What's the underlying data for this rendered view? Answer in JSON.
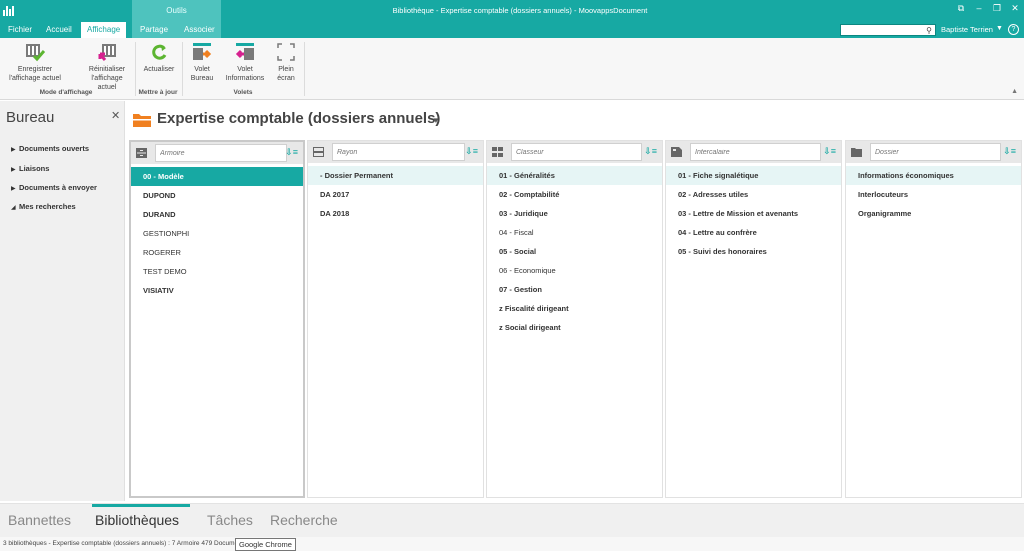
{
  "window": {
    "title": "Bibliothèque - Expertise comptable (dossiers annuels) - MoovappsDocument",
    "context_tab_label": "Outils",
    "controls": [
      "⧉",
      "–",
      "❐",
      "✕"
    ]
  },
  "menu": {
    "tabs": [
      "Fichier",
      "Accueil",
      "Affichage",
      "Partage",
      "Associer"
    ],
    "active_tab": "Affichage"
  },
  "header": {
    "search_placeholder": "",
    "user_name": "Baptiste Terrien",
    "help": "?"
  },
  "ribbon": {
    "save_view": "Enregistrer l'affichage actuel",
    "reset_view": "Réinitialiser l'affichage actuel",
    "group_display": "Mode d'affichage",
    "refresh": "Actualiser",
    "group_update": "Mettre à jour",
    "pane_desktop": "Volet Bureau",
    "pane_info": "Volet Informations",
    "fullscreen": "Plein écran",
    "group_panes": "Volets"
  },
  "sidebar": {
    "title": "Bureau",
    "close": "✕",
    "items": [
      {
        "label": "Documents ouverts",
        "marker": "▶"
      },
      {
        "label": "Liaisons",
        "marker": "▶"
      },
      {
        "label": "Documents à envoyer",
        "marker": "▶"
      },
      {
        "label": "Mes recherches",
        "marker": "◢"
      }
    ]
  },
  "main": {
    "title": "Expertise comptable (dossiers annuels)",
    "title_caret": "▼"
  },
  "columns": [
    {
      "placeholder": "Armoire",
      "items": [
        {
          "text": "00 - Modèle",
          "style": "sel"
        },
        {
          "text": "DUPOND",
          "style": "b"
        },
        {
          "text": "DURAND",
          "style": "b"
        },
        {
          "text": "GESTIONPHI",
          "style": ""
        },
        {
          "text": "ROGERER",
          "style": ""
        },
        {
          "text": "TEST DEMO",
          "style": ""
        },
        {
          "text": "VISIATIV",
          "style": "b"
        }
      ]
    },
    {
      "placeholder": "Rayon",
      "items": [
        {
          "text": "- Dossier Permanent",
          "style": "b hl"
        },
        {
          "text": "DA 2017",
          "style": "b"
        },
        {
          "text": "DA 2018",
          "style": "b"
        }
      ]
    },
    {
      "placeholder": "Classeur",
      "items": [
        {
          "text": "01 - Généralités",
          "style": "b hl"
        },
        {
          "text": "02 - Comptabilité",
          "style": "b"
        },
        {
          "text": "03 - Juridique",
          "style": "b"
        },
        {
          "text": "04 - Fiscal",
          "style": ""
        },
        {
          "text": "05 - Social",
          "style": "b"
        },
        {
          "text": "06 - Economique",
          "style": ""
        },
        {
          "text": "07 - Gestion",
          "style": "b"
        },
        {
          "text": "z Fiscalité dirigeant",
          "style": "b"
        },
        {
          "text": "z Social dirigeant",
          "style": "b"
        }
      ]
    },
    {
      "placeholder": "Intercalaire",
      "items": [
        {
          "text": "01 - Fiche signalétique",
          "style": "b hl"
        },
        {
          "text": "02 - Adresses utiles",
          "style": "b"
        },
        {
          "text": "03 - Lettre de Mission et avenants",
          "style": "b"
        },
        {
          "text": "04 - Lettre au confrère",
          "style": "b"
        },
        {
          "text": "05 - Suivi des honoraires",
          "style": "b"
        }
      ]
    },
    {
      "placeholder": "Dossier",
      "items": [
        {
          "text": "Informations économiques",
          "style": "b hl"
        },
        {
          "text": "Interlocuteurs",
          "style": "b"
        },
        {
          "text": "Organigramme",
          "style": "b"
        }
      ]
    }
  ],
  "bottom_tabs": [
    "Bannettes",
    "Bibliothèques",
    "Tâches",
    "Recherche"
  ],
  "bottom_active": "Bibliothèques",
  "status": {
    "text": "3 bibliothèques - Expertise comptable (dossiers annuels) : 7 Armoire 479 Documents",
    "tooltip": "Google Chrome"
  },
  "colors": {
    "accent": "#17a9a3",
    "accent_light": "#4ec3be"
  }
}
